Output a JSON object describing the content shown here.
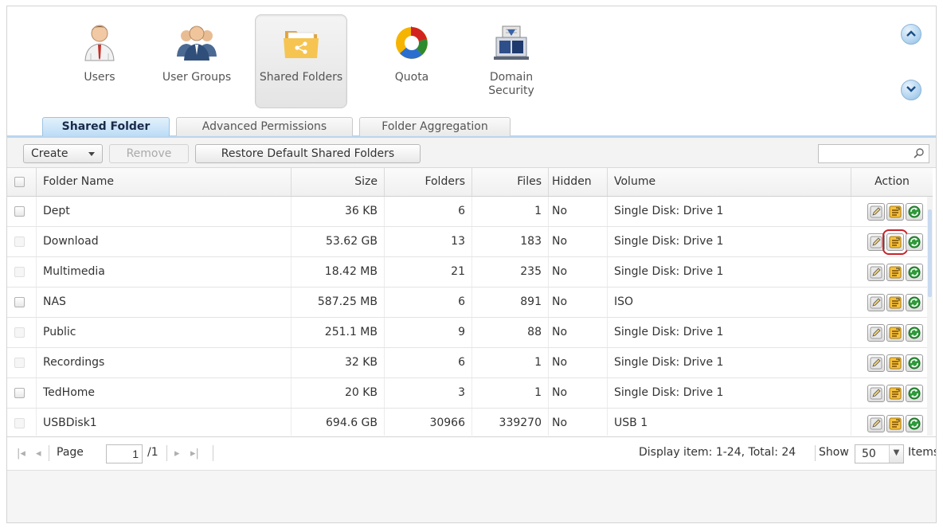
{
  "apps": [
    {
      "label": "Users",
      "icon": "user-icon"
    },
    {
      "label": "User Groups",
      "icon": "user-groups-icon"
    },
    {
      "label": "Shared Folders",
      "icon": "shared-folder-icon",
      "selected": true
    },
    {
      "label": "Quota",
      "icon": "quota-pie-icon"
    },
    {
      "label": "Domain Security",
      "icon": "domain-security-icon"
    }
  ],
  "tabs": [
    {
      "label": "Shared Folder",
      "active": true
    },
    {
      "label": "Advanced Permissions"
    },
    {
      "label": "Folder Aggregation"
    }
  ],
  "toolbar": {
    "create_label": "Create",
    "remove_label": "Remove",
    "restore_label": "Restore Default Shared Folders",
    "search_placeholder": ""
  },
  "columns": [
    "Folder Name",
    "Size",
    "Folders",
    "Files",
    "Hidden",
    "Volume",
    "Action"
  ],
  "rows": [
    {
      "name": "Dept",
      "size": "36 KB",
      "folders": "6",
      "files": "1",
      "hidden": "No",
      "volume": "Single Disk: Drive 1",
      "checkbox": "enabled"
    },
    {
      "name": "Download",
      "size": "53.62 GB",
      "folders": "13",
      "files": "183",
      "hidden": "No",
      "volume": "Single Disk: Drive 1",
      "checkbox": "disabled",
      "highlight_action": 1
    },
    {
      "name": "Multimedia",
      "size": "18.42 MB",
      "folders": "21",
      "files": "235",
      "hidden": "No",
      "volume": "Single Disk: Drive 1",
      "checkbox": "disabled"
    },
    {
      "name": "NAS",
      "size": "587.25 MB",
      "folders": "6",
      "files": "891",
      "hidden": "No",
      "volume": "ISO",
      "checkbox": "enabled"
    },
    {
      "name": "Public",
      "size": "251.1 MB",
      "folders": "9",
      "files": "88",
      "hidden": "No",
      "volume": "Single Disk: Drive 1",
      "checkbox": "disabled"
    },
    {
      "name": "Recordings",
      "size": "32 KB",
      "folders": "6",
      "files": "1",
      "hidden": "No",
      "volume": "Single Disk: Drive 1",
      "checkbox": "disabled"
    },
    {
      "name": "TedHome",
      "size": "20 KB",
      "folders": "3",
      "files": "1",
      "hidden": "No",
      "volume": "Single Disk: Drive 1",
      "checkbox": "enabled"
    },
    {
      "name": "USBDisk1",
      "size": "694.6 GB",
      "folders": "30966",
      "files": "339270",
      "hidden": "No",
      "volume": "USB 1",
      "checkbox": "disabled"
    }
  ],
  "action_icons": [
    "edit-icon",
    "permission-icon",
    "refresh-icon"
  ],
  "pager": {
    "page_label": "Page",
    "page_value": "1",
    "total_pages": "/1",
    "display_text": "Display item: 1-24, Total: 24",
    "show_label": "Show",
    "show_value": "50",
    "items_label": "Items"
  },
  "colors": {
    "accent": "#bcdcf6",
    "highlight": "#c8232a"
  }
}
